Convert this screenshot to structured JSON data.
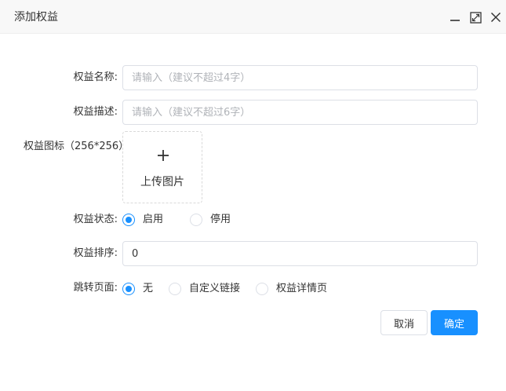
{
  "dialog": {
    "title": "添加权益"
  },
  "form": {
    "name": {
      "label": "权益名称:",
      "value": "",
      "placeholder": "请输入（建议不超过4字）"
    },
    "desc": {
      "label": "权益描述:",
      "value": "",
      "placeholder": "请输入（建议不超过6字）"
    },
    "icon": {
      "label": "权益图标（256*256）",
      "upload_label": "上传图片"
    },
    "status": {
      "label": "权益状态:",
      "options": [
        {
          "label": "启用",
          "checked": true
        },
        {
          "label": "停用",
          "checked": false
        }
      ]
    },
    "sort": {
      "label": "权益排序:",
      "value": "0"
    },
    "jump": {
      "label": "跳转页面:",
      "options": [
        {
          "label": "无",
          "checked": true
        },
        {
          "label": "自定义链接",
          "checked": false
        },
        {
          "label": "权益详情页",
          "checked": false
        }
      ]
    }
  },
  "actions": {
    "cancel_label": "取消",
    "confirm_label": "确定"
  },
  "colors": {
    "primary": "#1890ff",
    "border": "#dcdfe6",
    "titlebar_bg": "#f8f8f8"
  }
}
